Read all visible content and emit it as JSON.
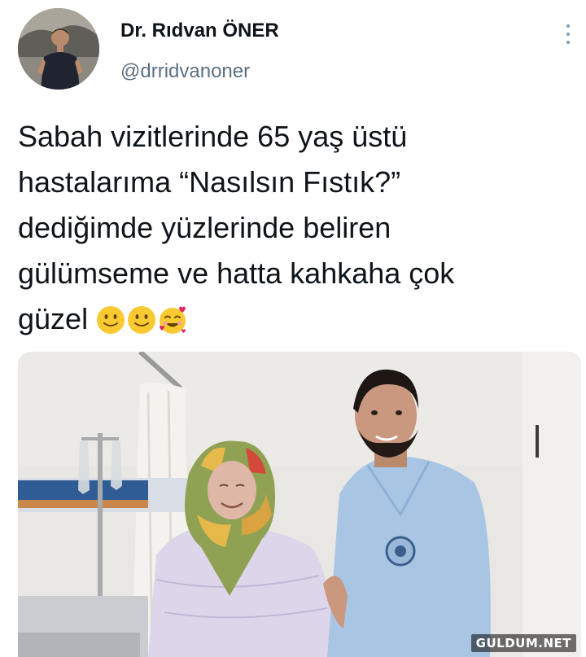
{
  "author": {
    "display_name": "Dr. Rıdvan ÖNER",
    "handle": "@drridvanoner"
  },
  "tweet": {
    "lines": [
      "Sabah vizitlerinde 65 yaş üstü",
      "hastalarıma “Nasılsın Fıstık?”",
      "dediğimde yüzlerinde beliren",
      "gülümseme ve hatta kahkaha çok",
      "güzel"
    ],
    "emojis": [
      "slightly-smiling-face",
      "slightly-smiling-face",
      "smiling-face-with-hearts"
    ]
  },
  "media": {
    "description_icon": "photo"
  },
  "watermark": "GULDUM.NET",
  "colors": {
    "text": "#0f1419",
    "secondary": "#5b7083",
    "emoji_yellow": "#f9c932",
    "scrubs": "#a8c6e4"
  }
}
